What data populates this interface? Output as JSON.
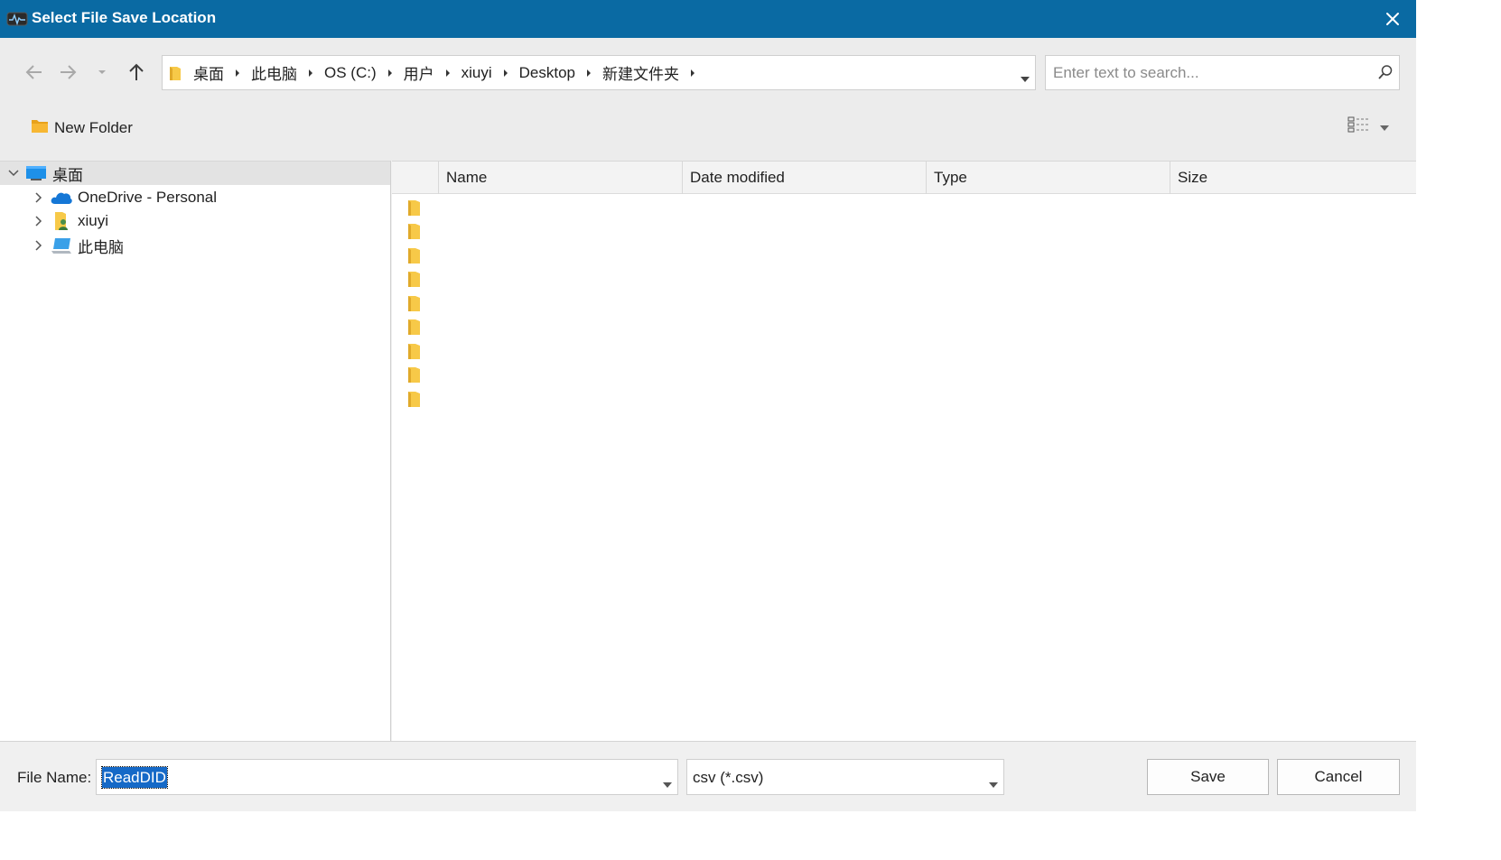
{
  "window": {
    "title": "Select File Save Location",
    "icons": {
      "app": "app-waveform-icon",
      "close": "close-icon"
    }
  },
  "nav": {
    "icons": {
      "back": "arrow-left-icon",
      "forward": "arrow-right-icon",
      "recent": "chevron-down-icon",
      "up": "arrow-up-icon"
    },
    "address": {
      "crumbs": [
        {
          "label": "桌面"
        },
        {
          "label": "此电脑"
        },
        {
          "label": "OS (C:)"
        },
        {
          "label": "用户"
        },
        {
          "label": "xiuyi"
        },
        {
          "label": "Desktop"
        },
        {
          "label": "新建文件夹"
        }
      ]
    },
    "search": {
      "placeholder": "Enter text to search..."
    }
  },
  "toolbar": {
    "new_folder_label": "New Folder",
    "view_icon": "details-view-icon"
  },
  "tree": {
    "items": [
      {
        "label": "桌面",
        "icon": "desktop-icon",
        "expanded": true,
        "selected": true,
        "level": 0
      },
      {
        "label": "OneDrive - Personal",
        "icon": "onedrive-cloud-icon",
        "expanded": false,
        "level": 1
      },
      {
        "label": "xiuyi",
        "icon": "user-folder-icon",
        "expanded": false,
        "level": 1
      },
      {
        "label": "此电脑",
        "icon": "this-pc-icon",
        "expanded": false,
        "level": 1
      }
    ]
  },
  "list": {
    "columns": [
      {
        "label": "Name"
      },
      {
        "label": "Date modified"
      },
      {
        "label": "Type"
      },
      {
        "label": "Size"
      }
    ],
    "rows": [
      {
        "icon": "folder-icon"
      },
      {
        "icon": "folder-icon"
      },
      {
        "icon": "folder-icon"
      },
      {
        "icon": "folder-icon"
      },
      {
        "icon": "folder-icon"
      },
      {
        "icon": "folder-icon"
      },
      {
        "icon": "folder-icon"
      },
      {
        "icon": "folder-icon"
      },
      {
        "icon": "folder-icon"
      }
    ]
  },
  "footer": {
    "file_name_label": "File Name:",
    "file_name_value": "ReadDID",
    "file_type_value": "csv (*.csv)",
    "save_label": "Save",
    "cancel_label": "Cancel"
  },
  "colors": {
    "titlebar": "#0a6aa3",
    "selection": "#1569c7",
    "folder": "#f7c948"
  }
}
